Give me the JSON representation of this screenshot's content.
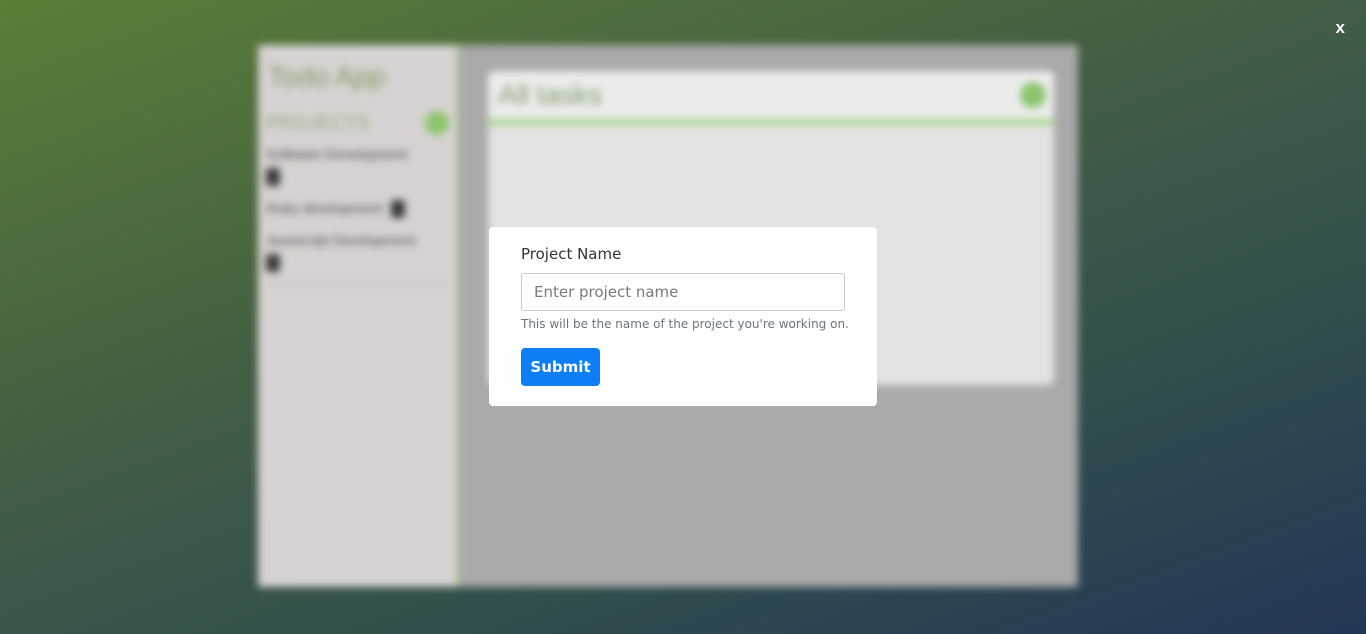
{
  "background_app": {
    "title": "Todo App",
    "projects_heading": "PROJECTS",
    "projects": [
      {
        "name": "Software Development"
      },
      {
        "name": "Ruby development"
      },
      {
        "name": "Javascript Development"
      }
    ],
    "main_title": "All tasks"
  },
  "close_label": "x",
  "modal": {
    "label": "Project Name",
    "input_value": "",
    "input_placeholder": "Enter project name",
    "help_text": "This will be the name of the project you're working on.",
    "submit_label": "Submit"
  },
  "colors": {
    "accent_green": "#8dc46c",
    "submit_blue": "#0d7ef5"
  }
}
